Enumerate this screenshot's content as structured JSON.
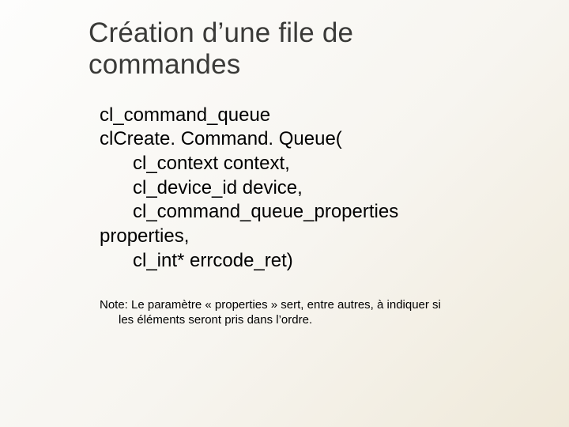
{
  "title_line1": "Création d’une file de",
  "title_line2": "commandes",
  "code": {
    "l1": "cl_command_queue",
    "l2": "clCreate. Command. Queue(",
    "l3": "cl_context context,",
    "l4": "cl_device_id device,",
    "l5": "cl_command_queue_properties",
    "l6": "properties,",
    "l7": "cl_int* errcode_ret)"
  },
  "note_line1": "Note: Le paramètre « properties » sert, entre autres, à indiquer si",
  "note_line2": "les éléments seront pris dans l’ordre."
}
